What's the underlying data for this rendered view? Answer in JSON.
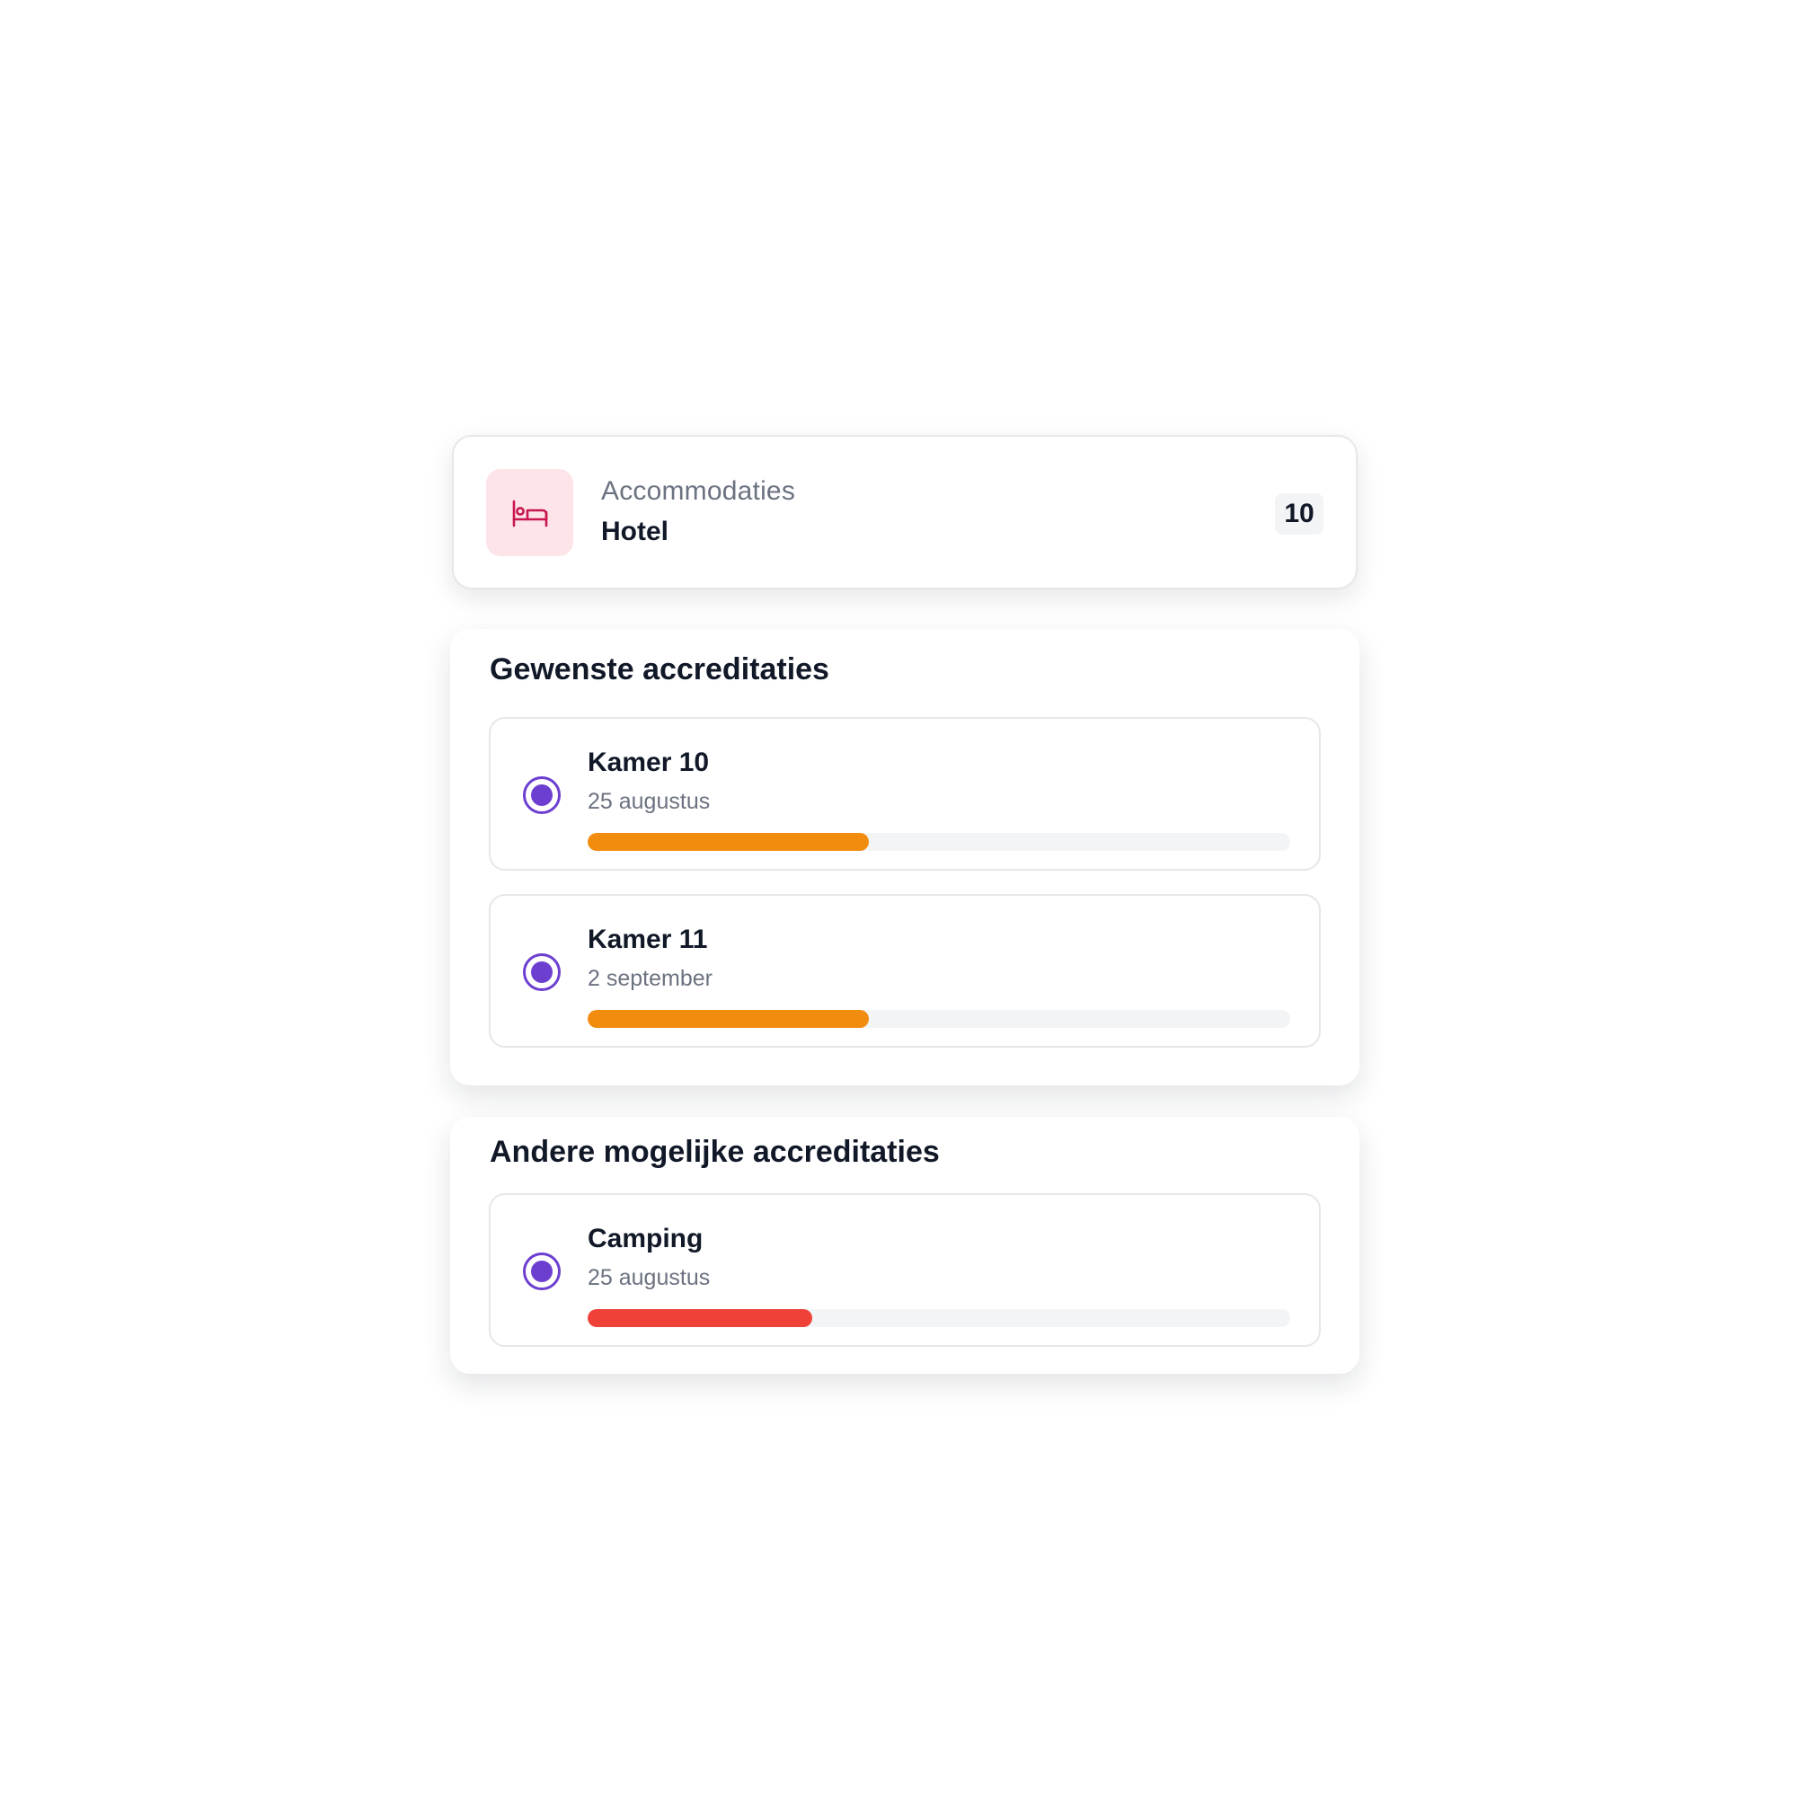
{
  "accommodation": {
    "kicker": "Accommodaties",
    "title": "Hotel",
    "count": "10",
    "icon": "bed-icon",
    "icon_color": "#c8174e",
    "icon_bg": "#fde4e8"
  },
  "sections": {
    "preferred": {
      "title": "Gewenste accreditaties",
      "items": [
        {
          "name": "Kamer 10",
          "date": "25 augustus",
          "progress": 0.4,
          "bar_color": "#f28c0f"
        },
        {
          "name": "Kamer 11",
          "date": "2 september",
          "progress": 0.4,
          "bar_color": "#f28c0f"
        }
      ]
    },
    "other": {
      "title": "Andere mogelijke accreditaties",
      "items": [
        {
          "name": "Camping",
          "date": "25 augustus",
          "progress": 0.32,
          "bar_color": "#ef4137"
        }
      ]
    }
  },
  "colors": {
    "accent": "#6d3fd0",
    "track": "#f3f4f6",
    "border": "#e5e7eb",
    "muted_text": "#6b7280"
  }
}
